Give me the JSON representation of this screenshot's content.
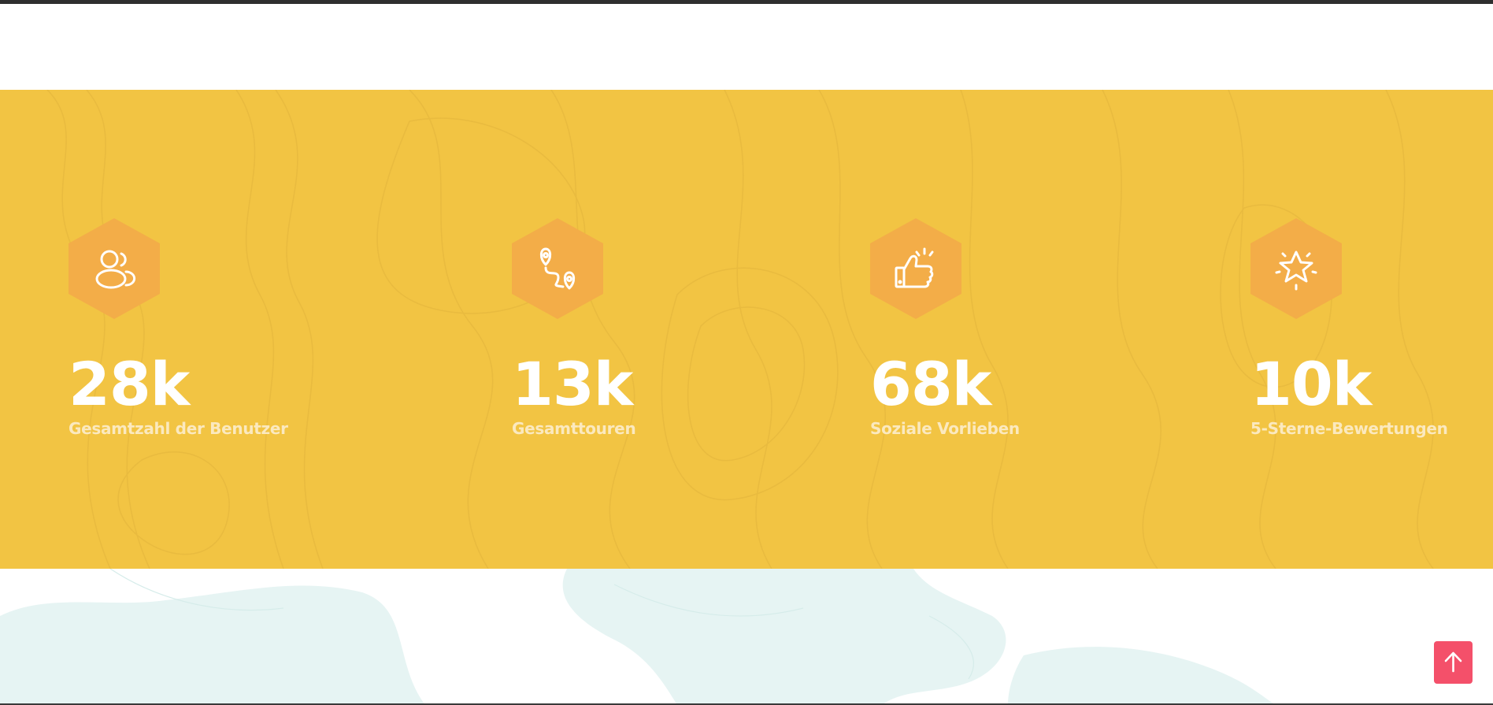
{
  "colors": {
    "band_background": "#F2C443",
    "hex_fill": "#F3AD48",
    "icon_stroke": "#FFFFFF",
    "value_color": "#FFFFFF",
    "label_color": "#FBE9BF",
    "scroll_button": "#F4506A",
    "map_tint": "#E6F4F3"
  },
  "stats": [
    {
      "icon": "users-icon",
      "value": "28k",
      "label": "Gesamtzahl der Benutzer"
    },
    {
      "icon": "route-icon",
      "value": "13k",
      "label": "Gesamttouren"
    },
    {
      "icon": "thumbs-up-icon",
      "value": "68k",
      "label": "Soziale Vorlieben"
    },
    {
      "icon": "star-icon",
      "value": "10k",
      "label": "5-Sterne-Bewertungen"
    }
  ],
  "scroll_top": {
    "icon": "arrow-up-icon"
  }
}
